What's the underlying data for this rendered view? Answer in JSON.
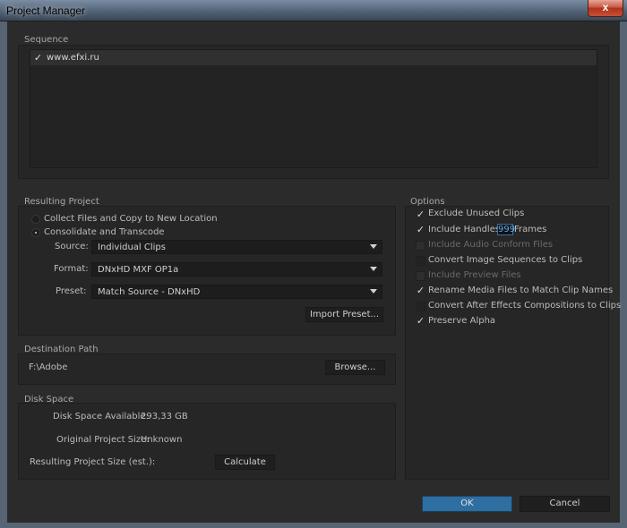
{
  "window": {
    "title": "Project Manager",
    "close_glyph": "x"
  },
  "sequence": {
    "label": "Sequence",
    "items": [
      {
        "name": "www.efxi.ru",
        "checked": true
      }
    ]
  },
  "resulting_project": {
    "label": "Resulting Project",
    "option_collect": "Collect Files and Copy to New Location",
    "option_consolidate": "Consolidate and Transcode",
    "selected": "consolidate",
    "source_label": "Source:",
    "source_value": "Individual Clips",
    "format_label": "Format:",
    "format_value": "DNxHD MXF OP1a",
    "preset_label": "Preset:",
    "preset_value": "Match Source - DNxHD",
    "import_preset_label": "Import Preset..."
  },
  "destination_path": {
    "label": "Destination Path",
    "path": "F:\\Adobe",
    "browse_label": "Browse..."
  },
  "disk_space": {
    "label": "Disk Space",
    "available_label": "Disk Space Available:",
    "available_value": "293,33 GB",
    "original_label": "Original Project Size:",
    "original_value": "Unknown",
    "resulting_label": "Resulting Project Size (est.):",
    "calculate_label": "Calculate"
  },
  "options": {
    "label": "Options",
    "exclude_unused": "Exclude Unused Clips",
    "include_handles": "Include Handles:",
    "handles_value": "999",
    "frames_label": "Frames",
    "include_audio_conform": "Include Audio Conform Files",
    "convert_image_sequences": "Convert Image Sequences to Clips",
    "include_preview": "Include Preview Files",
    "rename_media": "Rename Media Files to Match Clip Names",
    "convert_ae": "Convert After Effects Compositions to Clips",
    "preserve_alpha": "Preserve Alpha"
  },
  "footer": {
    "ok_label": "OK",
    "cancel_label": "Cancel"
  },
  "colors": {
    "accent": "#2e6ea0",
    "background": "#2b2b2b",
    "input_focus": "#3b6f9a"
  }
}
